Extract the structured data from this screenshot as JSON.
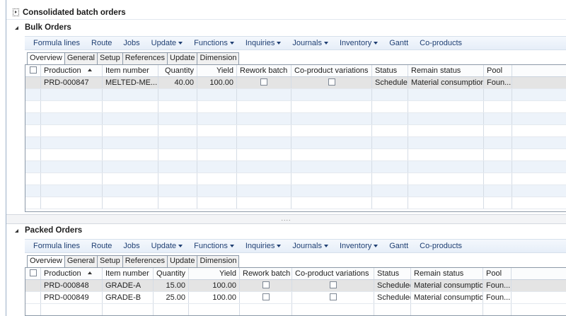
{
  "page": {
    "title": "Consolidated batch orders"
  },
  "bulk": {
    "title": "Bulk Orders",
    "actions": [
      {
        "label": "Formula lines",
        "dropdown": false
      },
      {
        "label": "Route",
        "dropdown": false
      },
      {
        "label": "Jobs",
        "dropdown": false
      },
      {
        "label": "Update",
        "dropdown": true
      },
      {
        "label": "Functions",
        "dropdown": true
      },
      {
        "label": "Inquiries",
        "dropdown": true
      },
      {
        "label": "Journals",
        "dropdown": true
      },
      {
        "label": "Inventory",
        "dropdown": true
      },
      {
        "label": "Gantt",
        "dropdown": false
      },
      {
        "label": "Co-products",
        "dropdown": false
      }
    ],
    "tabs": [
      "Overview",
      "General",
      "Setup",
      "References",
      "Update",
      "Dimension"
    ],
    "columns": [
      "Production",
      "Item number",
      "Quantity",
      "Yield",
      "Rework batch",
      "Co-product variations",
      "Status",
      "Remain status",
      "Pool"
    ],
    "rows": [
      {
        "production": "PRD-000847",
        "item": "MELTED-ME...",
        "quantity": "40.00",
        "yield": "100.00",
        "rework": false,
        "coproduct": false,
        "status": "Scheduled",
        "remain": "Material consumption",
        "pool": "Foun..."
      }
    ]
  },
  "packed": {
    "title": "Packed Orders",
    "actions": [
      {
        "label": "Formula lines",
        "dropdown": false
      },
      {
        "label": "Route",
        "dropdown": false
      },
      {
        "label": "Jobs",
        "dropdown": false
      },
      {
        "label": "Update",
        "dropdown": true
      },
      {
        "label": "Functions",
        "dropdown": true
      },
      {
        "label": "Inquiries",
        "dropdown": true
      },
      {
        "label": "Journals",
        "dropdown": true
      },
      {
        "label": "Inventory",
        "dropdown": true
      },
      {
        "label": "Gantt",
        "dropdown": false
      },
      {
        "label": "Co-products",
        "dropdown": false
      }
    ],
    "tabs": [
      "Overview",
      "General",
      "Setup",
      "References",
      "Update",
      "Dimension"
    ],
    "columns": [
      "Production",
      "Item number",
      "Quantity",
      "Yield",
      "Rework batch",
      "Co-product variations",
      "Status",
      "Remain status",
      "Pool"
    ],
    "rows": [
      {
        "production": "PRD-000848",
        "item": "GRADE-A",
        "quantity": "15.00",
        "yield": "100.00",
        "rework": false,
        "coproduct": false,
        "status": "Scheduled",
        "remain": "Material consumption",
        "pool": "Foun..."
      },
      {
        "production": "PRD-000849",
        "item": "GRADE-B",
        "quantity": "25.00",
        "yield": "100.00",
        "rework": false,
        "coproduct": false,
        "status": "Scheduled",
        "remain": "Material consumption",
        "pool": "Foun..."
      }
    ]
  },
  "splitter": {
    "grip": "...."
  }
}
